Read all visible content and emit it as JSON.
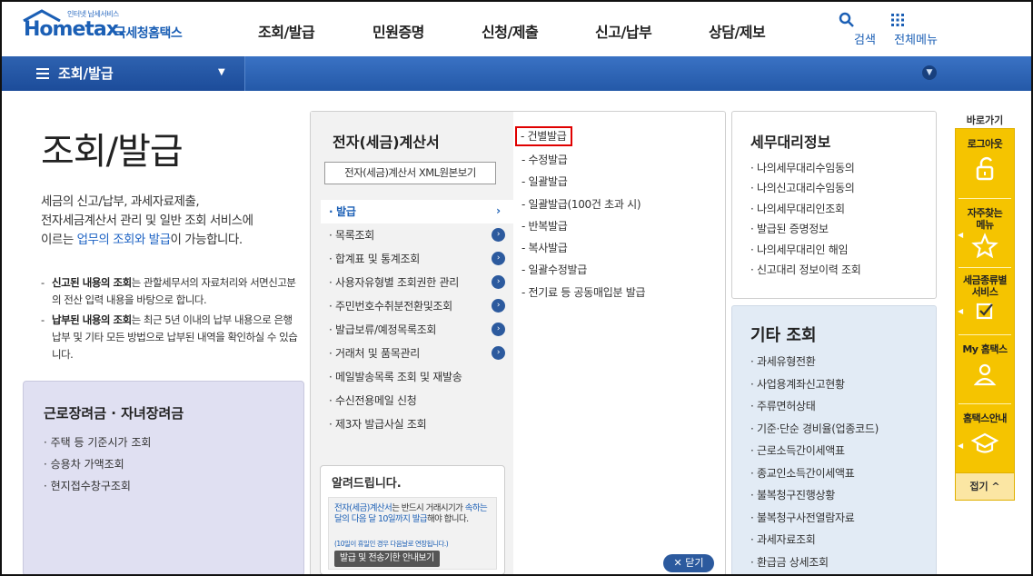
{
  "header": {
    "logo_tagline": "인터넷 납세서비스",
    "logo_main": "Hometax.",
    "logo_sub": "국세청홈택스",
    "nav": [
      "조회/발급",
      "민원증명",
      "신청/제출",
      "신고/납부",
      "상담/제보"
    ],
    "search_label": "검색",
    "allmenu_label": "전체메뉴"
  },
  "section_bar": {
    "title": "조회/발급"
  },
  "intro": {
    "title": "조회/발급",
    "text_1": "세금의 신고/납부, 과세자료제출,",
    "text_2": "전자세금계산서 관리 및 일반 조회 서비스에",
    "text_3_pre": "이르는 ",
    "text_3_link": "업무의 조회와 발급",
    "text_3_post": "이 가능합니다.",
    "note1_bold": "신고된 내용의 조회",
    "note1_rest": "는 관할세무서의 자료처리와 서면신고분의 전산 입력 내용을 바탕으로 합니다.",
    "note2_bold": "납부된 내용의 조회",
    "note2_rest": "는 최근 5년 이내의 납부 내용으로 은행 납부 및 기타 모든 방법으로 납부된 내역을 확인하실 수 있습니다."
  },
  "wage_box": {
    "title": "근로장려금 · 자녀장려금",
    "items": [
      "· 주택 등 기준시가 조회",
      "· 승용차 가액조회",
      "· 현지접수창구조회"
    ]
  },
  "einvoice": {
    "title": "전자(세금)계산서",
    "xml_button": "전자(세금)계산서 XML원본보기",
    "submenu": [
      "· 발급",
      "· 목록조회",
      "· 합계표 및 통계조회",
      "· 사용자유형별 조회권한 관리",
      "· 주민번호수취분전환및조회",
      "· 발급보류/예정목록조회",
      "· 거래처 및 품목관리",
      "· 메일발송목록 조회 및 재발송",
      "· 수신전용메일 신청",
      "· 제3자 발급사실 조회"
    ],
    "issue_items": [
      "- 건별발급",
      "- 수정발급",
      "- 일괄발급",
      "- 일괄발급(100건 초과 시)",
      "- 반복발급",
      "- 복사발급",
      "- 일괄수정발급",
      "- 전기료 등 공동매입분 발급"
    ],
    "close_button": "✕ 닫기",
    "notice": {
      "title": "알려드립니다.",
      "text_blue": "전자(세금)계산서",
      "text_mid": "는 반드시 거래시기가 ",
      "text_blue2": "속하는 달의 다음 달 10일까지 발급",
      "text_end": "해야 합니다.",
      "small": "(10일이 휴일인 경우 다음날로 연장됩니다.)",
      "button": "발급 및 전송기한 안내보기"
    }
  },
  "tax_agent": {
    "title": "세무대리정보",
    "items": [
      "· 나의세무대리수임동의",
      "· 나의신고대리수임동의",
      "· 나의세무대리인조회",
      "· 발급된 증명정보",
      "· 나의세무대리인 해임",
      "· 신고대리 정보이력 조회"
    ]
  },
  "etc": {
    "title": "기타 조회",
    "items": [
      "· 과세유형전환",
      "· 사업용계좌신고현황",
      "· 주류면허상태",
      "· 기준·단순 경비율(업종코드)",
      "· 근로소득간이세액표",
      "· 종교인소득간이세액표",
      "· 불복청구진행상황",
      "· 불복청구사전열람자료",
      "· 과세자료조회",
      "· 환급금 상세조회"
    ]
  },
  "quick": {
    "label": "바로가기",
    "items": [
      "로그아웃",
      "자주찾는 메뉴",
      "세금종류별 서비스",
      "My 홈택스",
      "홈택스안내"
    ],
    "fold": "접기 ^"
  },
  "colors": {
    "brand_blue": "#1b5fb5",
    "bar_blue": "#2459a8",
    "quick_yellow": "#f5c400",
    "highlight_red": "#e00000"
  }
}
